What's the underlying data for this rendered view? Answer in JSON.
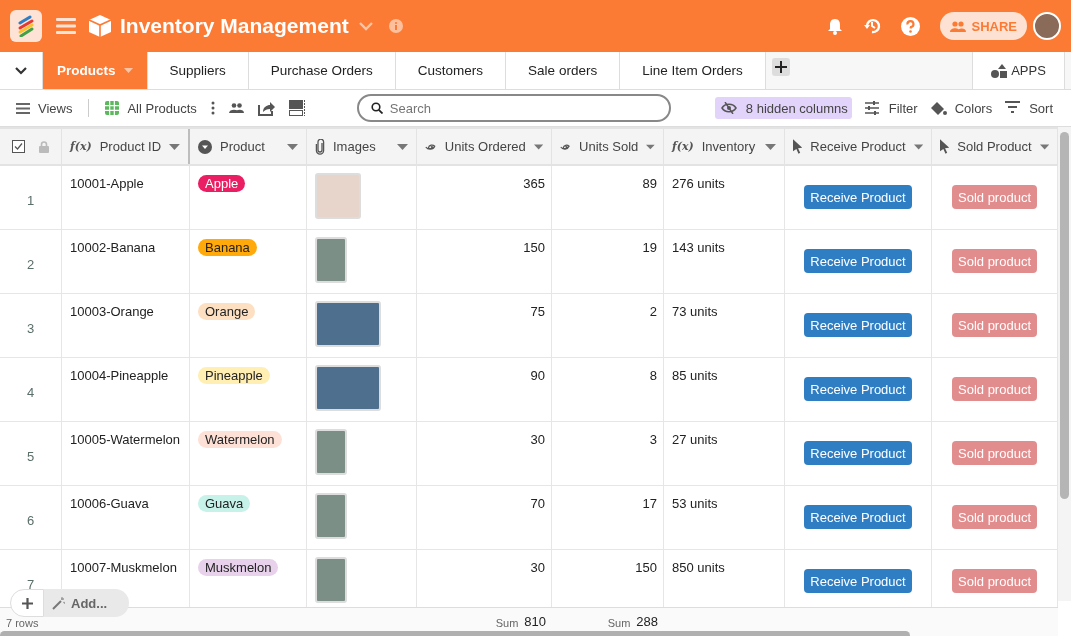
{
  "app": {
    "title": "Inventory Management",
    "share_label": "SHARE"
  },
  "tabs": [
    {
      "label": "Products",
      "selected": true
    },
    {
      "label": "Suppliers",
      "selected": false
    },
    {
      "label": "Purchase Orders",
      "selected": false
    },
    {
      "label": "Customers",
      "selected": false
    },
    {
      "label": "Sale orders",
      "selected": false
    },
    {
      "label": "Line Item Orders",
      "selected": false
    }
  ],
  "apps_label": "APPS",
  "toolbar": {
    "views_label": "Views",
    "view_name": "All Products",
    "search": {
      "placeholder": "Search"
    },
    "hidden_columns": "8 hidden columns",
    "filter": "Filter",
    "colors": "Colors",
    "sort": "Sort"
  },
  "table": {
    "columns": [
      {
        "label": "Product ID",
        "kind": "formula",
        "symbol": "f(x)"
      },
      {
        "label": "Product",
        "kind": "select"
      },
      {
        "label": "Images",
        "kind": "attachment"
      },
      {
        "label": "Units Ordered",
        "kind": "rollup",
        "summary": {
          "label": "Sum",
          "value": "810"
        }
      },
      {
        "label": "Units Sold",
        "kind": "rollup",
        "summary": {
          "label": "Sum",
          "value": "288"
        }
      },
      {
        "label": "Inventory",
        "kind": "formula",
        "symbol": "f(x)"
      },
      {
        "label": "Receive Product",
        "kind": "button"
      },
      {
        "label": "Sold Product",
        "kind": "button"
      }
    ],
    "rows": [
      {
        "number": "1",
        "id": "10001-Apple",
        "product": {
          "label": "Apple",
          "color": "#e91e63"
        },
        "image": {
          "kind": "square"
        },
        "ordered": "365",
        "sold": "89",
        "inventory": "276 units",
        "receive": "Receive Product",
        "sell": "Sold product"
      },
      {
        "number": "2",
        "id": "10002-Banana",
        "product": {
          "label": "Banana",
          "color": "#ffa90a"
        },
        "image": {
          "kind": "portrait"
        },
        "ordered": "150",
        "sold": "19",
        "inventory": "143 units",
        "receive": "Receive Product",
        "sell": "Sold product"
      },
      {
        "number": "3",
        "id": "10003-Orange",
        "product": {
          "label": "Orange",
          "color": "#fde0c2"
        },
        "image": {
          "kind": "landscape"
        },
        "ordered": "75",
        "sold": "2",
        "inventory": "73 units",
        "receive": "Receive Product",
        "sell": "Sold product"
      },
      {
        "number": "4",
        "id": "10004-Pineapple",
        "product": {
          "label": "Pineapple",
          "color": "#ffefb3"
        },
        "image": {
          "kind": "landscape"
        },
        "ordered": "90",
        "sold": "8",
        "inventory": "85 units",
        "receive": "Receive Product",
        "sell": "Sold product"
      },
      {
        "number": "5",
        "id": "10005-Watermelon",
        "product": {
          "label": "Watermelon",
          "color": "#fde1d7"
        },
        "image": {
          "kind": "portrait"
        },
        "ordered": "30",
        "sold": "3",
        "inventory": "27 units",
        "receive": "Receive Product",
        "sell": "Sold product"
      },
      {
        "number": "6",
        "id": "10006-Guava",
        "product": {
          "label": "Guava",
          "color": "#c6f2ea"
        },
        "image": {
          "kind": "portrait"
        },
        "ordered": "70",
        "sold": "17",
        "inventory": "53 units",
        "receive": "Receive Product",
        "sell": "Sold product"
      },
      {
        "number": "7",
        "id": "10007-Muskmelon",
        "product": {
          "label": "Muskmelon",
          "color": "#e7d1eb"
        },
        "image": {
          "kind": "portrait"
        },
        "ordered": "30",
        "sold": "150",
        "inventory": "850 units",
        "receive": "Receive Product",
        "sell": "Sold product"
      }
    ],
    "add_label": "Add...",
    "row_count": "7 rows"
  }
}
